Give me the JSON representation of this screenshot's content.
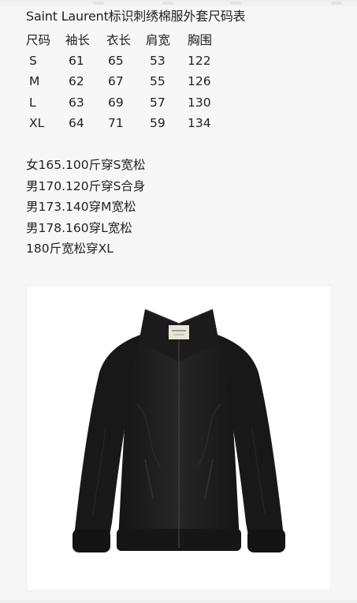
{
  "title": "Saint Laurent标识刺绣棉服外套尺码表",
  "size_table": {
    "headers": [
      "尺码",
      "袖长",
      "衣长",
      "肩宽",
      "胸围"
    ],
    "rows": [
      [
        "S",
        "61",
        "65",
        "53",
        "122"
      ],
      [
        "M",
        "62",
        "67",
        "55",
        "126"
      ],
      [
        "L",
        "63",
        "69",
        "57",
        "130"
      ],
      [
        "XL",
        "64",
        "71",
        "59",
        "134"
      ]
    ]
  },
  "fit_notes": [
    "女165.100斤穿S宽松",
    "男170.120斤穿S合身",
    "男173.140穿M宽松",
    "男178.160穿L宽松",
    "180斤宽松穿XL"
  ],
  "colors": {
    "page_background": "#f7f7f7",
    "text": "#222222",
    "jacket": "#1c1c1c",
    "label": "#e9e5da"
  },
  "image": {
    "subject": "black nylon zip-up track jacket with embroidered neck label"
  }
}
